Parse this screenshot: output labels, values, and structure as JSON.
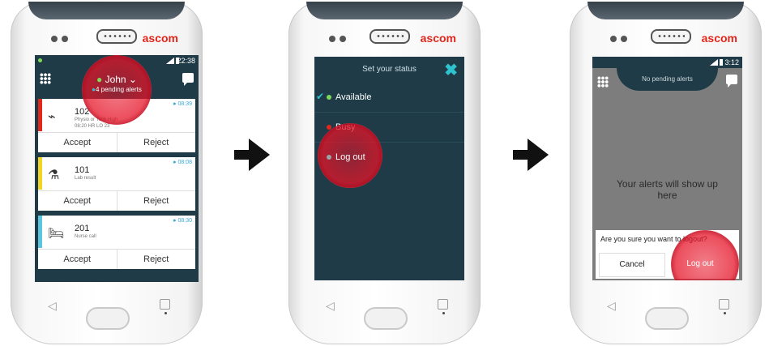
{
  "brand": "ascom",
  "arrows": [
    "right-arrow",
    "right-arrow"
  ],
  "phone1": {
    "time": "22:38",
    "user": {
      "name": "John ⌄",
      "pending": "4 pending alerts"
    },
    "alerts": [
      {
        "number": "102",
        "desc1": "Physio or Tech High",
        "desc2": "08:20 HR LO 23",
        "time": "08:39",
        "color": "#e1261c",
        "icon": "heartbeat-icon",
        "accept": "Accept",
        "reject": "Reject"
      },
      {
        "number": "101",
        "desc1": "Lab result",
        "desc2": "",
        "time": "08:08",
        "color": "#f2d422",
        "icon": "flask-icon",
        "accept": "Accept",
        "reject": "Reject"
      },
      {
        "number": "201",
        "desc1": "Nurse call",
        "desc2": "",
        "time": "08:30",
        "color": "#5bc5e0",
        "icon": "bed-icon",
        "accept": "Accept",
        "reject": "Reject"
      }
    ]
  },
  "phone2": {
    "title": "Set your status",
    "options": [
      {
        "label": "Available",
        "color": "#7ed957",
        "selected": true
      },
      {
        "label": "Busy",
        "color": "#e1261c",
        "selected": false
      },
      {
        "label": "Log out",
        "color": "#9aa5aa",
        "selected": false
      }
    ]
  },
  "phone3": {
    "time": "3:12",
    "header": "No pending alerts",
    "empty": "Your alerts will show up here",
    "dialog": {
      "question": "Are you sure you want to logout?",
      "cancel": "Cancel",
      "logout": "Log out"
    }
  },
  "colors": {
    "accent": "#2fc3d0",
    "highlight_red": "#e1261c",
    "screen_bg": "#1e3b47"
  }
}
